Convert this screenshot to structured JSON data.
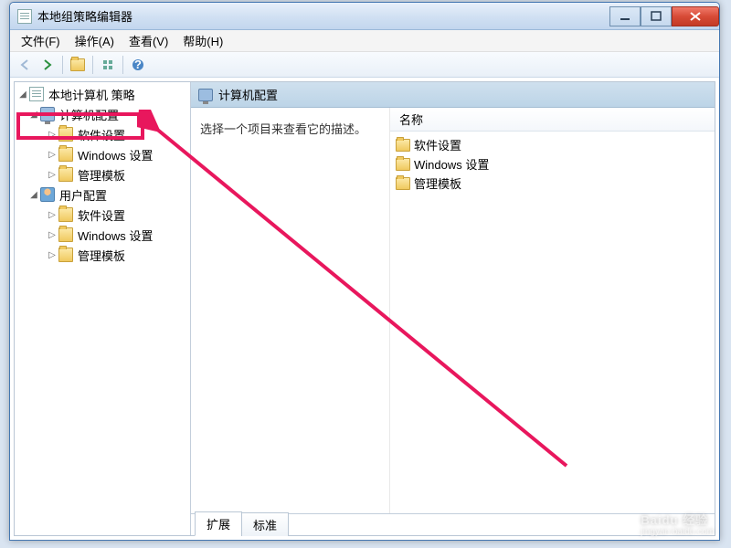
{
  "window": {
    "title": "本地组策略编辑器"
  },
  "menu": {
    "file": "文件(F)",
    "action": "操作(A)",
    "view": "查看(V)",
    "help": "帮助(H)"
  },
  "tree": {
    "root": "本地计算机 策略",
    "computer_config": "计算机配置",
    "user_config": "用户配置",
    "software_settings": "软件设置",
    "windows_settings": "Windows 设置",
    "admin_templates": "管理模板"
  },
  "detail": {
    "header": "计算机配置",
    "hint": "选择一个项目来查看它的描述。",
    "column_name": "名称",
    "rows": [
      "软件设置",
      "Windows 设置",
      "管理模板"
    ]
  },
  "tabs": {
    "extended": "扩展",
    "standard": "标准"
  },
  "watermark": {
    "main": "Baidu 经验",
    "sub": "jingyan.baidu.com"
  }
}
